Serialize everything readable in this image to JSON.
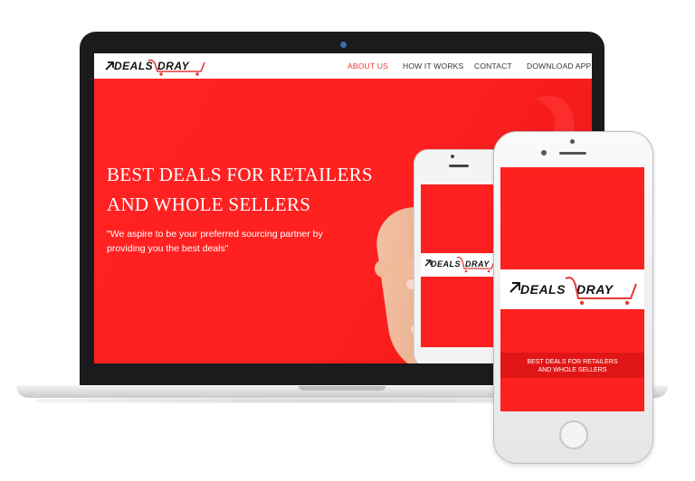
{
  "brand": {
    "logo_text": "DEALS DRAY",
    "logo_left": "DEALS",
    "logo_right": "DRAY",
    "accent": "#ff1f1f"
  },
  "nav": {
    "items": [
      {
        "label": "ABOUT US",
        "active": true
      },
      {
        "label": "HOW IT WORKS",
        "active": false
      },
      {
        "label": "CONTACT",
        "active": false
      },
      {
        "label": "DOWNLOAD APP",
        "active": false
      }
    ]
  },
  "hero": {
    "title_line1": "BEST DEALS FOR RETAILERS",
    "title_line2": "AND WHOLE SELLERS",
    "quote_line1": "\"We aspire to be your preferred sourcing partner by",
    "quote_line2": "providing you the best deals\""
  },
  "phone_screen": {
    "tagline_line1": "BEST DEALS FOR RETAILERS",
    "tagline_line2": "AND WHOLE SELLERS"
  },
  "colors": {
    "primary_red": "#ff1f1f",
    "white": "#ffffff",
    "device_black": "#1b1b1d"
  },
  "icons": [
    "cart-icon",
    "camera-icon",
    "home-button-icon",
    "speaker-icon"
  ]
}
